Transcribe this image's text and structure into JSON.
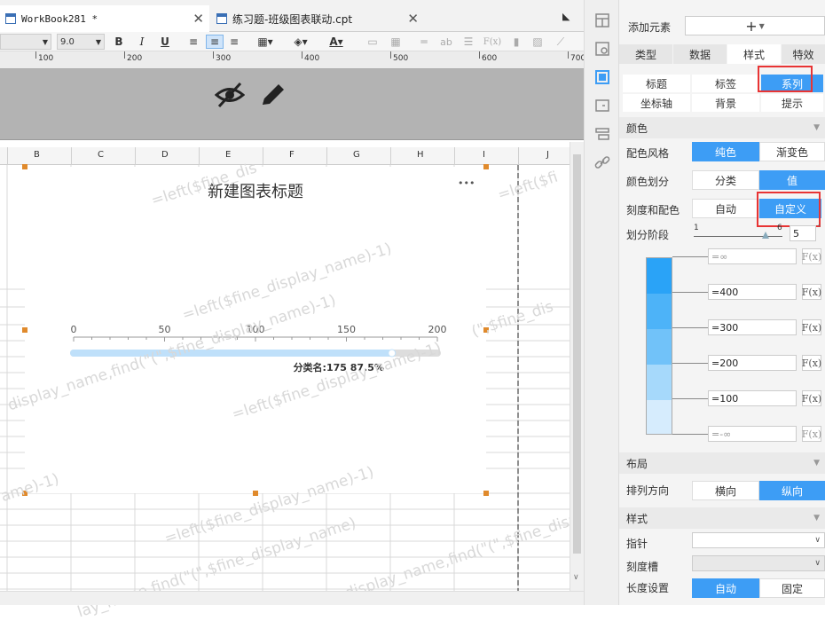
{
  "tabs": [
    {
      "label": "WorkBook281 *"
    },
    {
      "label": "练习题-班级图表联动.cpt"
    }
  ],
  "toolbar": {
    "font_size": "9.0",
    "bold": "B",
    "italic": "I",
    "underline": "U",
    "text_a": "ab",
    "fx": "F(x)"
  },
  "ruler": [
    "100",
    "200",
    "300",
    "400",
    "500",
    "600",
    "700"
  ],
  "columns": [
    "B",
    "C",
    "D",
    "E",
    "F",
    "G",
    "H",
    "I",
    "J"
  ],
  "chart": {
    "title": "新建图表标题",
    "more": "•••",
    "label": "分类名:175 87.5%",
    "ticks": [
      "0",
      "50",
      "100",
      "150",
      "200"
    ]
  },
  "chart_data": {
    "type": "bar",
    "categories": [
      "分类名"
    ],
    "values": [
      175
    ],
    "percent": "87.5%",
    "xlim": [
      0,
      200
    ],
    "ticks": [
      0,
      50,
      100,
      150,
      200
    ],
    "title": "新建图表标题"
  },
  "watermarks": [
    "=left($fine_dis",
    "=left($fine_display_name)-1)",
    "=left($fine_display_name)-1)",
    "display_name,find(\"(\",$fine_display_name)-1)",
    "=left($fine_display_name)-1)",
    "display_name,find(\"(\",$fine_display_name)-1)",
    "=left($fi",
    "(\",$fine_dis",
    "ame)-1)",
    "lay_name,find(\"(\",$fine_display_name)"
  ],
  "panel": {
    "add_element": "添加元素",
    "add_symbol": "+",
    "main_tabs": [
      "类型",
      "数据",
      "样式",
      "特效"
    ],
    "sub_tabs": [
      "标题",
      "标签",
      "系列",
      "坐标轴",
      "背景",
      "提示"
    ],
    "color_section": "颜色",
    "color_style_label": "配色风格",
    "color_style_options": [
      "纯色",
      "渐变色"
    ],
    "color_divide_label": "颜色划分",
    "color_divide_options": [
      "分类",
      "值"
    ],
    "scale_color_label": "刻度和配色",
    "scale_color_options": [
      "自动",
      "自定义"
    ],
    "stage_label": "划分阶段",
    "slider_min": "1",
    "slider_max": "6",
    "stage_value": "5",
    "stops": [
      "=∞",
      "=400",
      "=300",
      "=200",
      "=100",
      "=-∞"
    ],
    "fx_label": "F(x)",
    "layout_section": "布局",
    "direction_label": "排列方向",
    "direction_options": [
      "横向",
      "纵向"
    ],
    "style_section": "样式",
    "pointer_label": "指针",
    "scale_slot_label": "刻度槽",
    "length_label": "长度设置",
    "length_options": [
      "自动",
      "固定"
    ]
  },
  "colors": {
    "accent": "#3d9df5",
    "bar": "#bfe0fa",
    "track": "#dddddd",
    "red": "#e83434"
  }
}
